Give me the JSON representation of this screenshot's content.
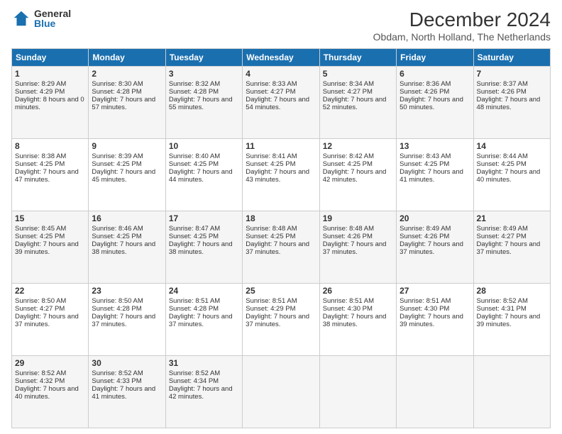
{
  "logo": {
    "general": "General",
    "blue": "Blue"
  },
  "header": {
    "title": "December 2024",
    "subtitle": "Obdam, North Holland, The Netherlands"
  },
  "days": [
    "Sunday",
    "Monday",
    "Tuesday",
    "Wednesday",
    "Thursday",
    "Friday",
    "Saturday"
  ],
  "weeks": [
    [
      {
        "day": "1",
        "sunrise": "Sunrise: 8:29 AM",
        "sunset": "Sunset: 4:29 PM",
        "daylight": "Daylight: 8 hours and 0 minutes."
      },
      {
        "day": "2",
        "sunrise": "Sunrise: 8:30 AM",
        "sunset": "Sunset: 4:28 PM",
        "daylight": "Daylight: 7 hours and 57 minutes."
      },
      {
        "day": "3",
        "sunrise": "Sunrise: 8:32 AM",
        "sunset": "Sunset: 4:28 PM",
        "daylight": "Daylight: 7 hours and 55 minutes."
      },
      {
        "day": "4",
        "sunrise": "Sunrise: 8:33 AM",
        "sunset": "Sunset: 4:27 PM",
        "daylight": "Daylight: 7 hours and 54 minutes."
      },
      {
        "day": "5",
        "sunrise": "Sunrise: 8:34 AM",
        "sunset": "Sunset: 4:27 PM",
        "daylight": "Daylight: 7 hours and 52 minutes."
      },
      {
        "day": "6",
        "sunrise": "Sunrise: 8:36 AM",
        "sunset": "Sunset: 4:26 PM",
        "daylight": "Daylight: 7 hours and 50 minutes."
      },
      {
        "day": "7",
        "sunrise": "Sunrise: 8:37 AM",
        "sunset": "Sunset: 4:26 PM",
        "daylight": "Daylight: 7 hours and 48 minutes."
      }
    ],
    [
      {
        "day": "8",
        "sunrise": "Sunrise: 8:38 AM",
        "sunset": "Sunset: 4:25 PM",
        "daylight": "Daylight: 7 hours and 47 minutes."
      },
      {
        "day": "9",
        "sunrise": "Sunrise: 8:39 AM",
        "sunset": "Sunset: 4:25 PM",
        "daylight": "Daylight: 7 hours and 45 minutes."
      },
      {
        "day": "10",
        "sunrise": "Sunrise: 8:40 AM",
        "sunset": "Sunset: 4:25 PM",
        "daylight": "Daylight: 7 hours and 44 minutes."
      },
      {
        "day": "11",
        "sunrise": "Sunrise: 8:41 AM",
        "sunset": "Sunset: 4:25 PM",
        "daylight": "Daylight: 7 hours and 43 minutes."
      },
      {
        "day": "12",
        "sunrise": "Sunrise: 8:42 AM",
        "sunset": "Sunset: 4:25 PM",
        "daylight": "Daylight: 7 hours and 42 minutes."
      },
      {
        "day": "13",
        "sunrise": "Sunrise: 8:43 AM",
        "sunset": "Sunset: 4:25 PM",
        "daylight": "Daylight: 7 hours and 41 minutes."
      },
      {
        "day": "14",
        "sunrise": "Sunrise: 8:44 AM",
        "sunset": "Sunset: 4:25 PM",
        "daylight": "Daylight: 7 hours and 40 minutes."
      }
    ],
    [
      {
        "day": "15",
        "sunrise": "Sunrise: 8:45 AM",
        "sunset": "Sunset: 4:25 PM",
        "daylight": "Daylight: 7 hours and 39 minutes."
      },
      {
        "day": "16",
        "sunrise": "Sunrise: 8:46 AM",
        "sunset": "Sunset: 4:25 PM",
        "daylight": "Daylight: 7 hours and 38 minutes."
      },
      {
        "day": "17",
        "sunrise": "Sunrise: 8:47 AM",
        "sunset": "Sunset: 4:25 PM",
        "daylight": "Daylight: 7 hours and 38 minutes."
      },
      {
        "day": "18",
        "sunrise": "Sunrise: 8:48 AM",
        "sunset": "Sunset: 4:25 PM",
        "daylight": "Daylight: 7 hours and 37 minutes."
      },
      {
        "day": "19",
        "sunrise": "Sunrise: 8:48 AM",
        "sunset": "Sunset: 4:26 PM",
        "daylight": "Daylight: 7 hours and 37 minutes."
      },
      {
        "day": "20",
        "sunrise": "Sunrise: 8:49 AM",
        "sunset": "Sunset: 4:26 PM",
        "daylight": "Daylight: 7 hours and 37 minutes."
      },
      {
        "day": "21",
        "sunrise": "Sunrise: 8:49 AM",
        "sunset": "Sunset: 4:27 PM",
        "daylight": "Daylight: 7 hours and 37 minutes."
      }
    ],
    [
      {
        "day": "22",
        "sunrise": "Sunrise: 8:50 AM",
        "sunset": "Sunset: 4:27 PM",
        "daylight": "Daylight: 7 hours and 37 minutes."
      },
      {
        "day": "23",
        "sunrise": "Sunrise: 8:50 AM",
        "sunset": "Sunset: 4:28 PM",
        "daylight": "Daylight: 7 hours and 37 minutes."
      },
      {
        "day": "24",
        "sunrise": "Sunrise: 8:51 AM",
        "sunset": "Sunset: 4:28 PM",
        "daylight": "Daylight: 7 hours and 37 minutes."
      },
      {
        "day": "25",
        "sunrise": "Sunrise: 8:51 AM",
        "sunset": "Sunset: 4:29 PM",
        "daylight": "Daylight: 7 hours and 37 minutes."
      },
      {
        "day": "26",
        "sunrise": "Sunrise: 8:51 AM",
        "sunset": "Sunset: 4:30 PM",
        "daylight": "Daylight: 7 hours and 38 minutes."
      },
      {
        "day": "27",
        "sunrise": "Sunrise: 8:51 AM",
        "sunset": "Sunset: 4:30 PM",
        "daylight": "Daylight: 7 hours and 39 minutes."
      },
      {
        "day": "28",
        "sunrise": "Sunrise: 8:52 AM",
        "sunset": "Sunset: 4:31 PM",
        "daylight": "Daylight: 7 hours and 39 minutes."
      }
    ],
    [
      {
        "day": "29",
        "sunrise": "Sunrise: 8:52 AM",
        "sunset": "Sunset: 4:32 PM",
        "daylight": "Daylight: 7 hours and 40 minutes."
      },
      {
        "day": "30",
        "sunrise": "Sunrise: 8:52 AM",
        "sunset": "Sunset: 4:33 PM",
        "daylight": "Daylight: 7 hours and 41 minutes."
      },
      {
        "day": "31",
        "sunrise": "Sunrise: 8:52 AM",
        "sunset": "Sunset: 4:34 PM",
        "daylight": "Daylight: 7 hours and 42 minutes."
      },
      null,
      null,
      null,
      null
    ]
  ]
}
